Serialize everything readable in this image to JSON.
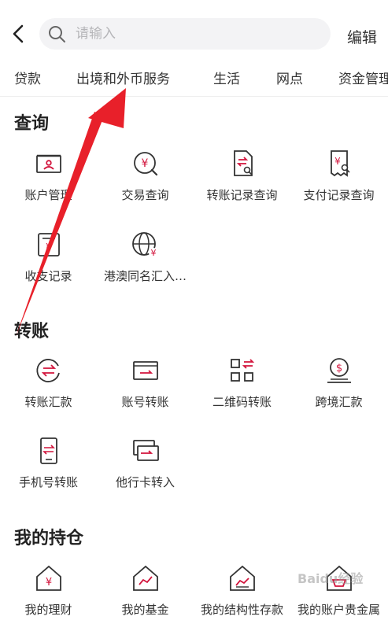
{
  "header": {
    "search_placeholder": "请输入",
    "edit_label": "编辑"
  },
  "tabs": [
    {
      "label": "贷款"
    },
    {
      "label": "出境和外币服务"
    },
    {
      "label": "生活"
    },
    {
      "label": "网点"
    },
    {
      "label": "资金管理"
    }
  ],
  "sections": {
    "query": {
      "title": "查询",
      "items": [
        {
          "label": "账户管理",
          "icon": "account-card-icon"
        },
        {
          "label": "交易查询",
          "icon": "yuan-search-icon"
        },
        {
          "label": "转账记录查询",
          "icon": "transfer-doc-search-icon"
        },
        {
          "label": "支付记录查询",
          "icon": "payment-doc-search-icon"
        },
        {
          "label": "收支记录",
          "icon": "income-record-icon"
        },
        {
          "label": "港澳同名汇入…",
          "icon": "globe-yuan-icon"
        }
      ]
    },
    "transfer": {
      "title": "转账",
      "items": [
        {
          "label": "转账汇款",
          "icon": "transfer-cycle-icon"
        },
        {
          "label": "账号转账",
          "icon": "account-transfer-icon"
        },
        {
          "label": "二维码转账",
          "icon": "qr-transfer-icon"
        },
        {
          "label": "跨境汇款",
          "icon": "cross-border-coin-icon"
        },
        {
          "label": "手机号转账",
          "icon": "phone-transfer-icon"
        },
        {
          "label": "他行卡转入",
          "icon": "other-bank-card-icon"
        }
      ]
    },
    "holdings": {
      "title": "我的持仓",
      "items": [
        {
          "label": "我的理财",
          "icon": "house-yuan-icon"
        },
        {
          "label": "我的基金",
          "icon": "house-chart-icon"
        },
        {
          "label": "我的结构性存款",
          "icon": "house-trend-icon"
        },
        {
          "label": "我的账户贵金属",
          "icon": "house-gold-icon"
        }
      ]
    }
  },
  "watermark": "Baidu经验",
  "colors": {
    "accent": "#d2143c",
    "annotation_arrow": "#e8202a"
  }
}
